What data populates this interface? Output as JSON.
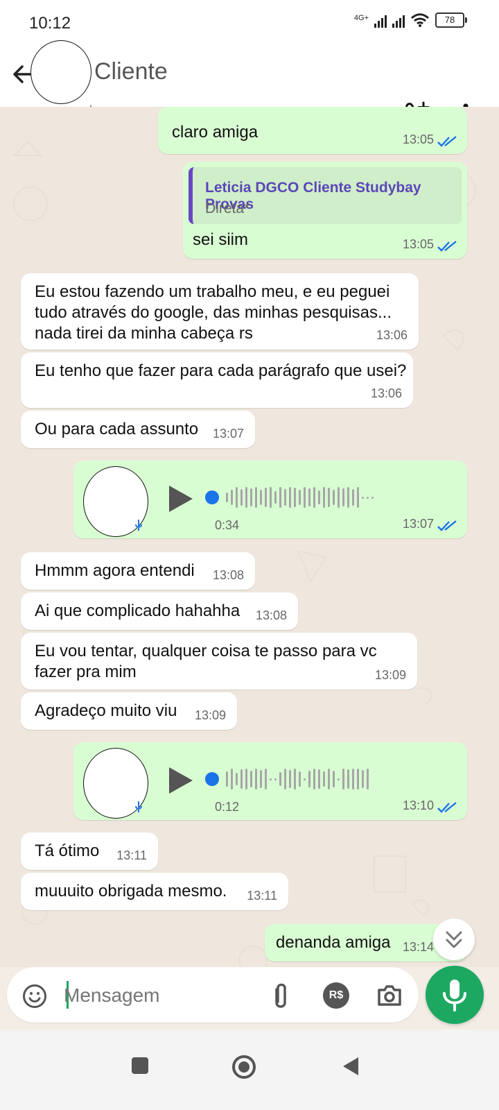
{
  "status": {
    "time": "10:12",
    "network": "4G+",
    "battery": "78"
  },
  "header": {
    "contact_name": "Cliente"
  },
  "messages": {
    "m1": {
      "text": "claro amiga",
      "time": "13:05"
    },
    "m2": {
      "quote_title": "Leticia DGCO Cliente Studybay Provas",
      "quote_subtitle": "Direta*",
      "text": "sei siim",
      "time": "13:05"
    },
    "m3": {
      "text": "Eu estou fazendo um trabalho meu, e eu peguei tudo através do google, das minhas pesquisas... nada tirei da minha cabeça rs",
      "time": "13:06"
    },
    "m4": {
      "text": "Eu tenho que fazer para cada parágrafo que usei?",
      "time": "13:06"
    },
    "m5": {
      "text": "Ou para cada assunto",
      "time": "13:07"
    },
    "voice1": {
      "duration": "0:34",
      "time": "13:07"
    },
    "m6": {
      "text": "Hmmm agora entendi",
      "time": "13:08"
    },
    "m7": {
      "text": "Ai que complicado hahahha",
      "time": "13:08"
    },
    "m8": {
      "text": "Eu vou tentar, qualquer coisa te passo para vc fazer pra mim",
      "time": "13:09"
    },
    "m9": {
      "text": "Agradeço muito viu",
      "time": "13:09"
    },
    "voice2": {
      "duration": "0:12",
      "time": "13:10"
    },
    "m10": {
      "text": "Tá ótimo",
      "time": "13:11"
    },
    "m11": {
      "text": "muuuito obrigada mesmo.",
      "time": "13:11"
    },
    "m12": {
      "text": "denanda amiga",
      "time": "13:14"
    }
  },
  "composer": {
    "placeholder": "Mensagem",
    "pix_label": "R$"
  },
  "icons": {
    "back": "back-arrow-icon",
    "call_add": "call-add-icon",
    "menu": "more-vertical-icon",
    "emoji": "emoji-icon",
    "attach": "paperclip-icon",
    "camera": "camera-icon",
    "mic": "microphone-icon",
    "play": "play-icon",
    "scroll": "chevron-double-down-icon"
  },
  "colors": {
    "outgoing": "#d9fdd3",
    "incoming": "#ffffff",
    "accent": "#1da862",
    "read_ticks": "#1a73e8"
  }
}
